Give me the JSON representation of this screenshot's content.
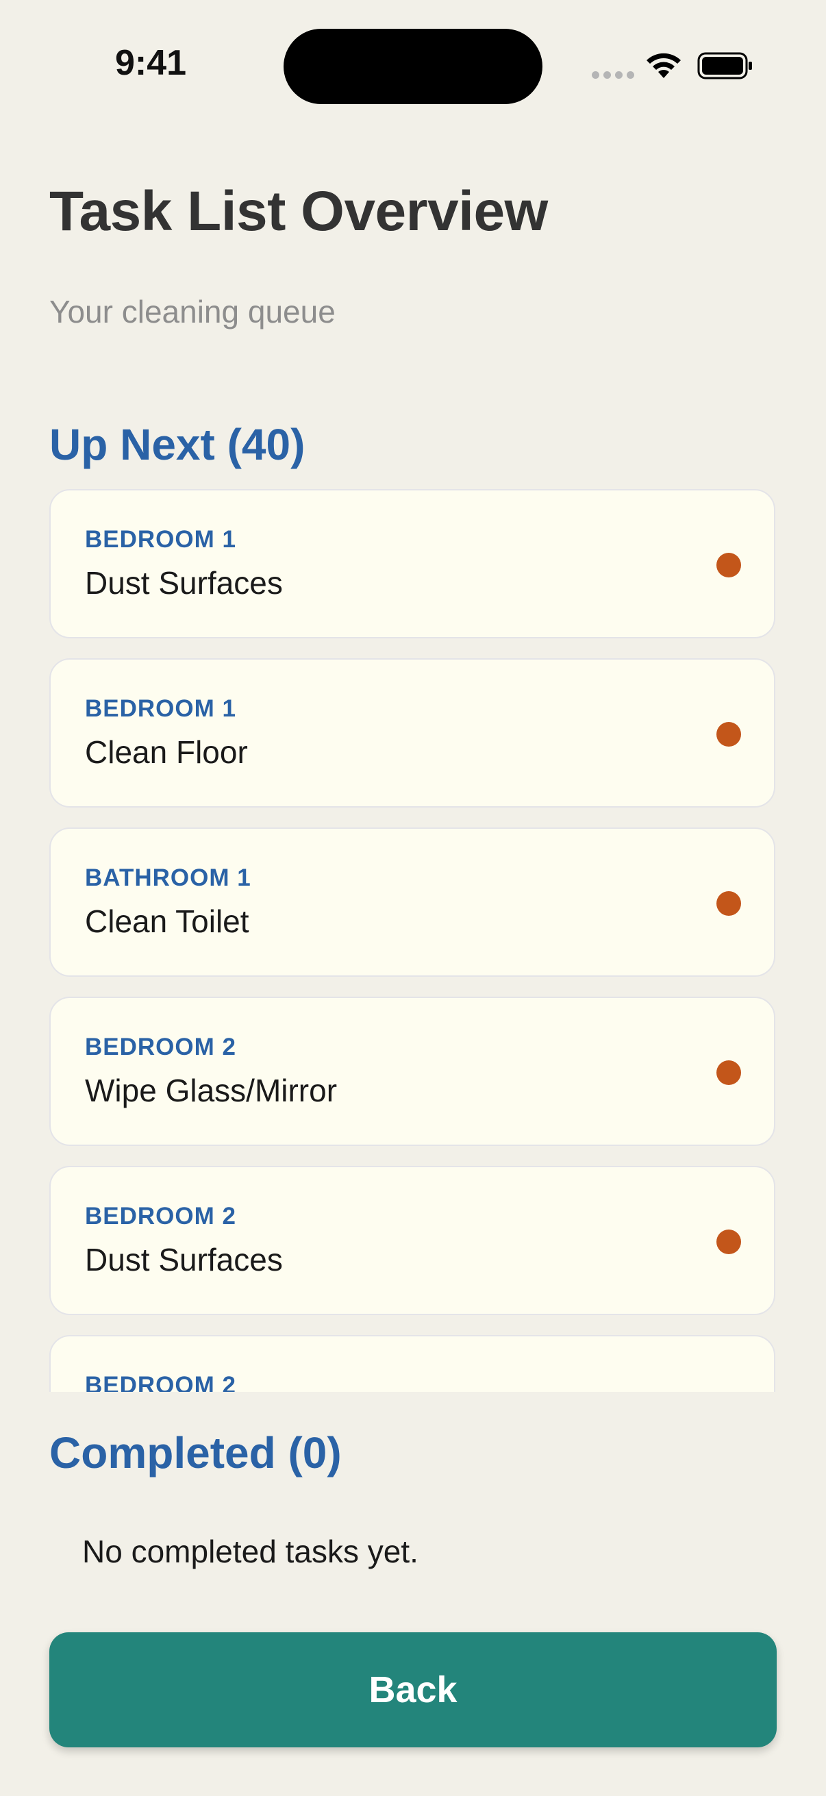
{
  "status_bar": {
    "time": "9:41",
    "icons": [
      "cellular-signal-icon",
      "wifi-icon",
      "battery-icon"
    ]
  },
  "header": {
    "title": "Task List Overview",
    "subtitle": "Your cleaning queue"
  },
  "up_next": {
    "title": "Up Next (40)",
    "tasks": [
      {
        "room": "BEDROOM 1",
        "name": "Dust Surfaces",
        "status_color": "#c3561a"
      },
      {
        "room": "BEDROOM 1",
        "name": "Clean Floor",
        "status_color": "#c3561a"
      },
      {
        "room": "BATHROOM 1",
        "name": "Clean Toilet",
        "status_color": "#c3561a"
      },
      {
        "room": "BEDROOM 2",
        "name": "Wipe Glass/Mirror",
        "status_color": "#c3561a"
      },
      {
        "room": "BEDROOM 2",
        "name": "Dust Surfaces",
        "status_color": "#c3561a"
      },
      {
        "room": "BEDROOM 2",
        "name": "",
        "status_color": "#c3561a"
      }
    ]
  },
  "completed": {
    "title": "Completed (0)",
    "empty_message": "No completed tasks yet."
  },
  "footer": {
    "back_label": "Back"
  },
  "colors": {
    "background": "#f2f0e8",
    "accent_blue": "#2a62a6",
    "card_background": "#fefdf0",
    "status_dot": "#c3561a",
    "button_teal": "#23857b"
  }
}
